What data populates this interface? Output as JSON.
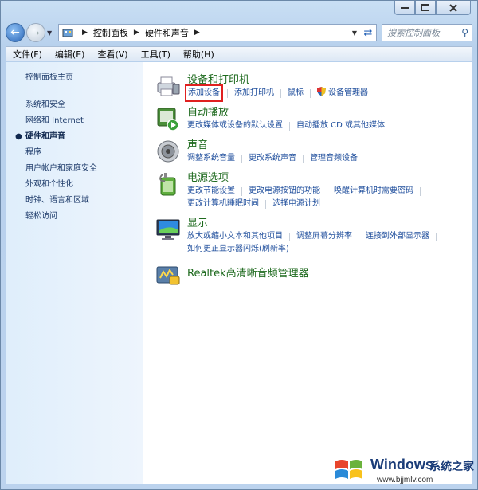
{
  "address": {
    "crumbs": [
      "控制面板",
      "硬件和声音"
    ],
    "search_placeholder": "搜索控制面板"
  },
  "menu": [
    "文件(F)",
    "编辑(E)",
    "查看(V)",
    "工具(T)",
    "帮助(H)"
  ],
  "sidebar": {
    "home": "控制面板主页",
    "items": [
      "系统和安全",
      "网络和 Internet",
      "硬件和声音",
      "程序",
      "用户帐户和家庭安全",
      "外观和个性化",
      "时钟、语言和区域",
      "轻松访问"
    ],
    "active_index": 2
  },
  "categories": [
    {
      "title": "设备和打印机",
      "icon": "devices-printers-icon",
      "links": [
        "添加设备",
        "添加打印机",
        "鼠标",
        "设备管理器"
      ]
    },
    {
      "title": "自动播放",
      "icon": "autoplay-icon",
      "links": [
        "更改媒体或设备的默认设置",
        "自动播放 CD 或其他媒体"
      ]
    },
    {
      "title": "声音",
      "icon": "speaker-icon",
      "links": [
        "调整系统音量",
        "更改系统声音",
        "管理音频设备"
      ]
    },
    {
      "title": "电源选项",
      "icon": "power-options-icon",
      "links": [
        "更改节能设置",
        "更改电源按钮的功能",
        "唤醒计算机时需要密码",
        "更改计算机睡眠时间",
        "选择电源计划"
      ]
    },
    {
      "title": "显示",
      "icon": "display-icon",
      "links": [
        "放大或缩小文本和其他项目",
        "调整屏幕分辨率",
        "连接到外部显示器",
        "如何更正显示器闪烁(刷新率)"
      ]
    },
    {
      "title": "Realtek高清晰音频管理器",
      "icon": "realtek-audio-icon",
      "links": []
    }
  ],
  "highlight": {
    "category": 0,
    "link": 0,
    "color": "#e02020"
  },
  "watermark": {
    "brand": "Windows",
    "cn": "系统之家",
    "url": "www.bjjmlv.com"
  }
}
